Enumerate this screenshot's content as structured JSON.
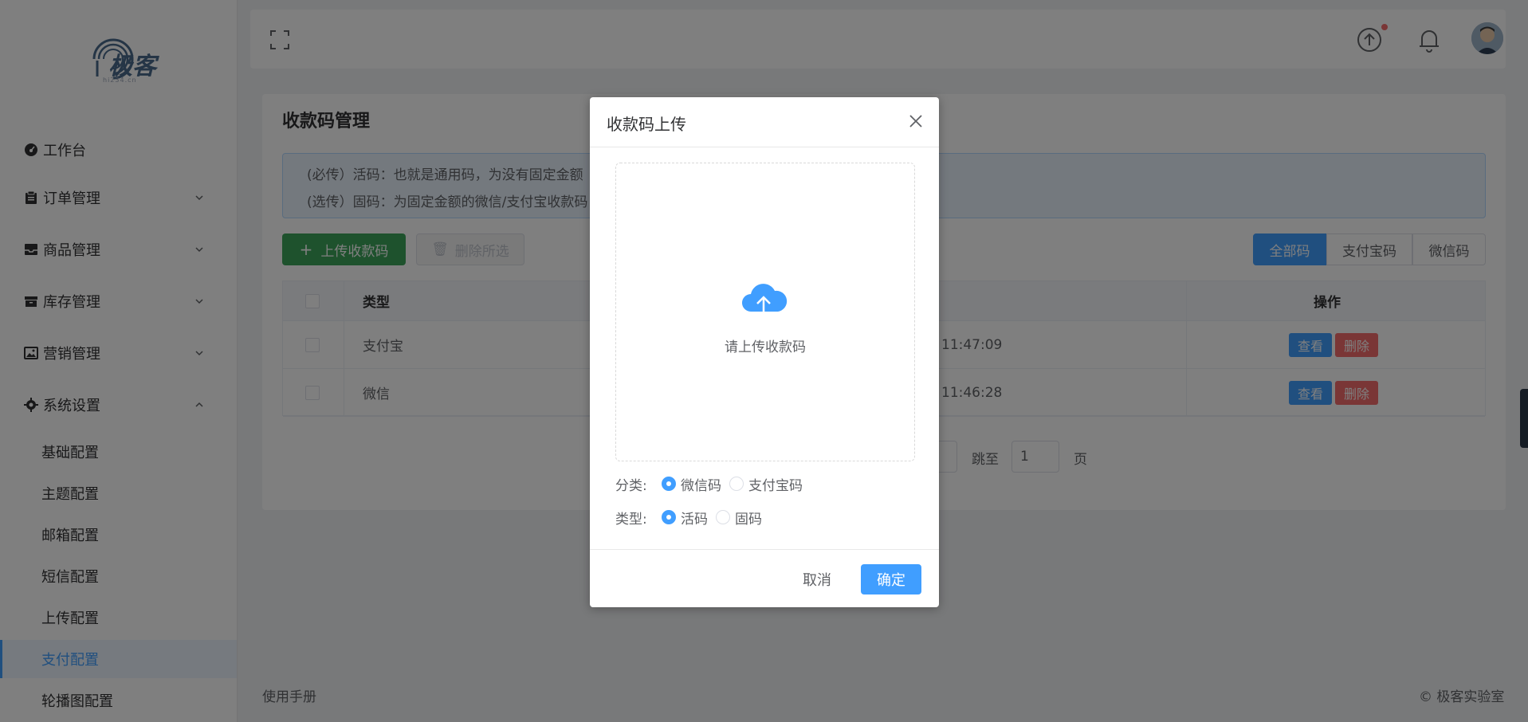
{
  "logo": {
    "text": "极客",
    "sub": "hi234.cn"
  },
  "sidebar": {
    "menus": [
      {
        "label": "工作台",
        "icon": "dashboard-icon",
        "expandable": false
      },
      {
        "label": "订单管理",
        "icon": "clipboard-icon",
        "expandable": true
      },
      {
        "label": "商品管理",
        "icon": "inbox-icon",
        "expandable": true
      },
      {
        "label": "库存管理",
        "icon": "box-icon",
        "expandable": true
      },
      {
        "label": "营销管理",
        "icon": "picture-icon",
        "expandable": true
      },
      {
        "label": "系统设置",
        "icon": "gear-icon",
        "expandable": true,
        "expanded": true
      }
    ],
    "submenus": [
      {
        "label": "基础配置"
      },
      {
        "label": "主题配置"
      },
      {
        "label": "邮箱配置"
      },
      {
        "label": "短信配置"
      },
      {
        "label": "上传配置"
      },
      {
        "label": "支付配置",
        "active": true
      },
      {
        "label": "轮播图配置"
      }
    ]
  },
  "header": {
    "fullscreen_icon": "fullscreen-icon",
    "upload_icon": "upload-circle-icon",
    "bell_icon": "bell-icon",
    "avatar": "user-avatar"
  },
  "main": {
    "title": "收款码管理",
    "alert_lines": [
      "(必传）活码：也就是通用码，为没有固定金额",
      "(选传）固码：为固定金额的微信/支付宝收款码"
    ],
    "upload_button": "上传收款码",
    "delete_button": "删除所选",
    "filters": [
      "全部码",
      "支付宝码",
      "微信码"
    ],
    "table": {
      "headers": [
        "类型",
        "操作"
      ],
      "rows": [
        {
          "type": "支付宝",
          "time": "11:47:09",
          "view": "查看",
          "del": "删除"
        },
        {
          "type": "微信",
          "time": "11:46:28",
          "view": "查看",
          "del": "删除"
        }
      ]
    },
    "pager": {
      "goto": "跳至",
      "page_value": "1",
      "page_suffix": "页"
    }
  },
  "footer": {
    "left": "使用手册",
    "right": "© 极客实验室"
  },
  "dialog": {
    "title": "收款码上传",
    "upload_hint": "请上传收款码",
    "category_label": "分类:",
    "category_options": [
      "微信码",
      "支付宝码"
    ],
    "category_selected": "微信码",
    "type_label": "类型:",
    "type_options": [
      "活码",
      "固码"
    ],
    "type_selected": "活码",
    "cancel": "取消",
    "confirm": "确定"
  },
  "colors": {
    "primary": "#409eff",
    "success": "#3da55b",
    "danger": "#f56c6c"
  }
}
